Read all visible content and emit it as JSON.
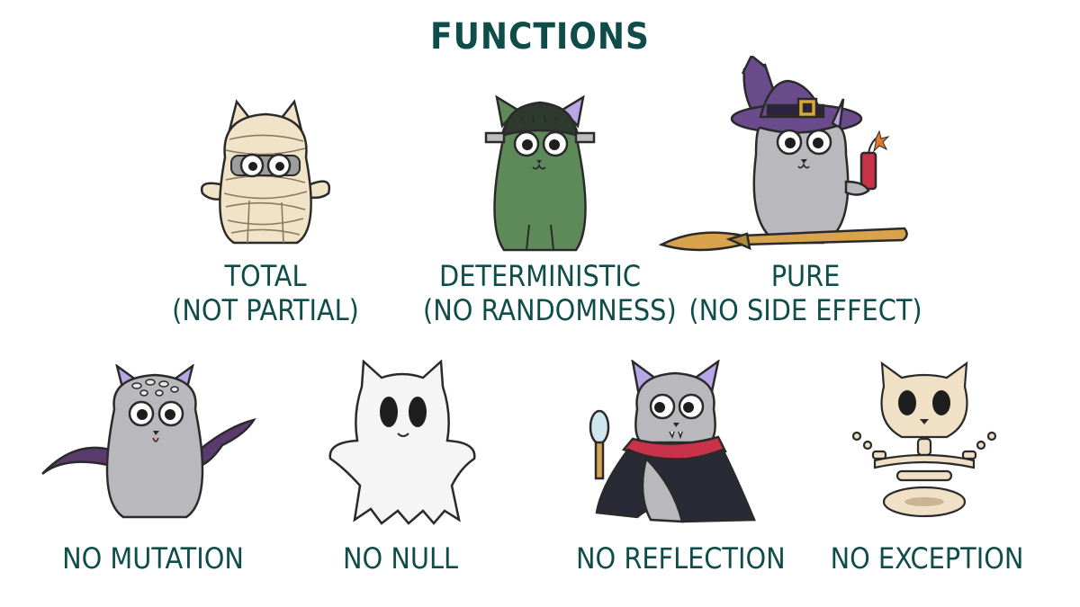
{
  "title": "FUNCTIONS",
  "top_row": [
    {
      "line1": "TOTAL",
      "line2": "(NOT PARTIAL)",
      "icon": "mummy-cat-icon"
    },
    {
      "line1": "DETERMINISTIC",
      "line2": "(NO RANDOMNESS)",
      "icon": "frankenstein-cat-icon"
    },
    {
      "line1": "PURE",
      "line2": "(NO SIDE EFFECT)",
      "icon": "witch-cat-icon"
    }
  ],
  "bottom_row": [
    {
      "line1": "NO MUTATION",
      "icon": "octopus-cat-icon"
    },
    {
      "line1": "NO NULL",
      "icon": "ghost-cat-icon"
    },
    {
      "line1": "NO REFLECTION",
      "icon": "vampire-cat-icon"
    },
    {
      "line1": "NO EXCEPTION",
      "icon": "skeleton-cat-icon"
    }
  ],
  "colors": {
    "text": "#0f4d4a",
    "cat_gray": "#b9b9bd",
    "cat_green": "#5e8a5a",
    "mummy": "#f1e3c8",
    "ghost": "#f5f5f5",
    "bone": "#efe0c6",
    "hat": "#6a4c8c",
    "tentacle": "#5a3b6e",
    "cape": "#c8334a"
  }
}
